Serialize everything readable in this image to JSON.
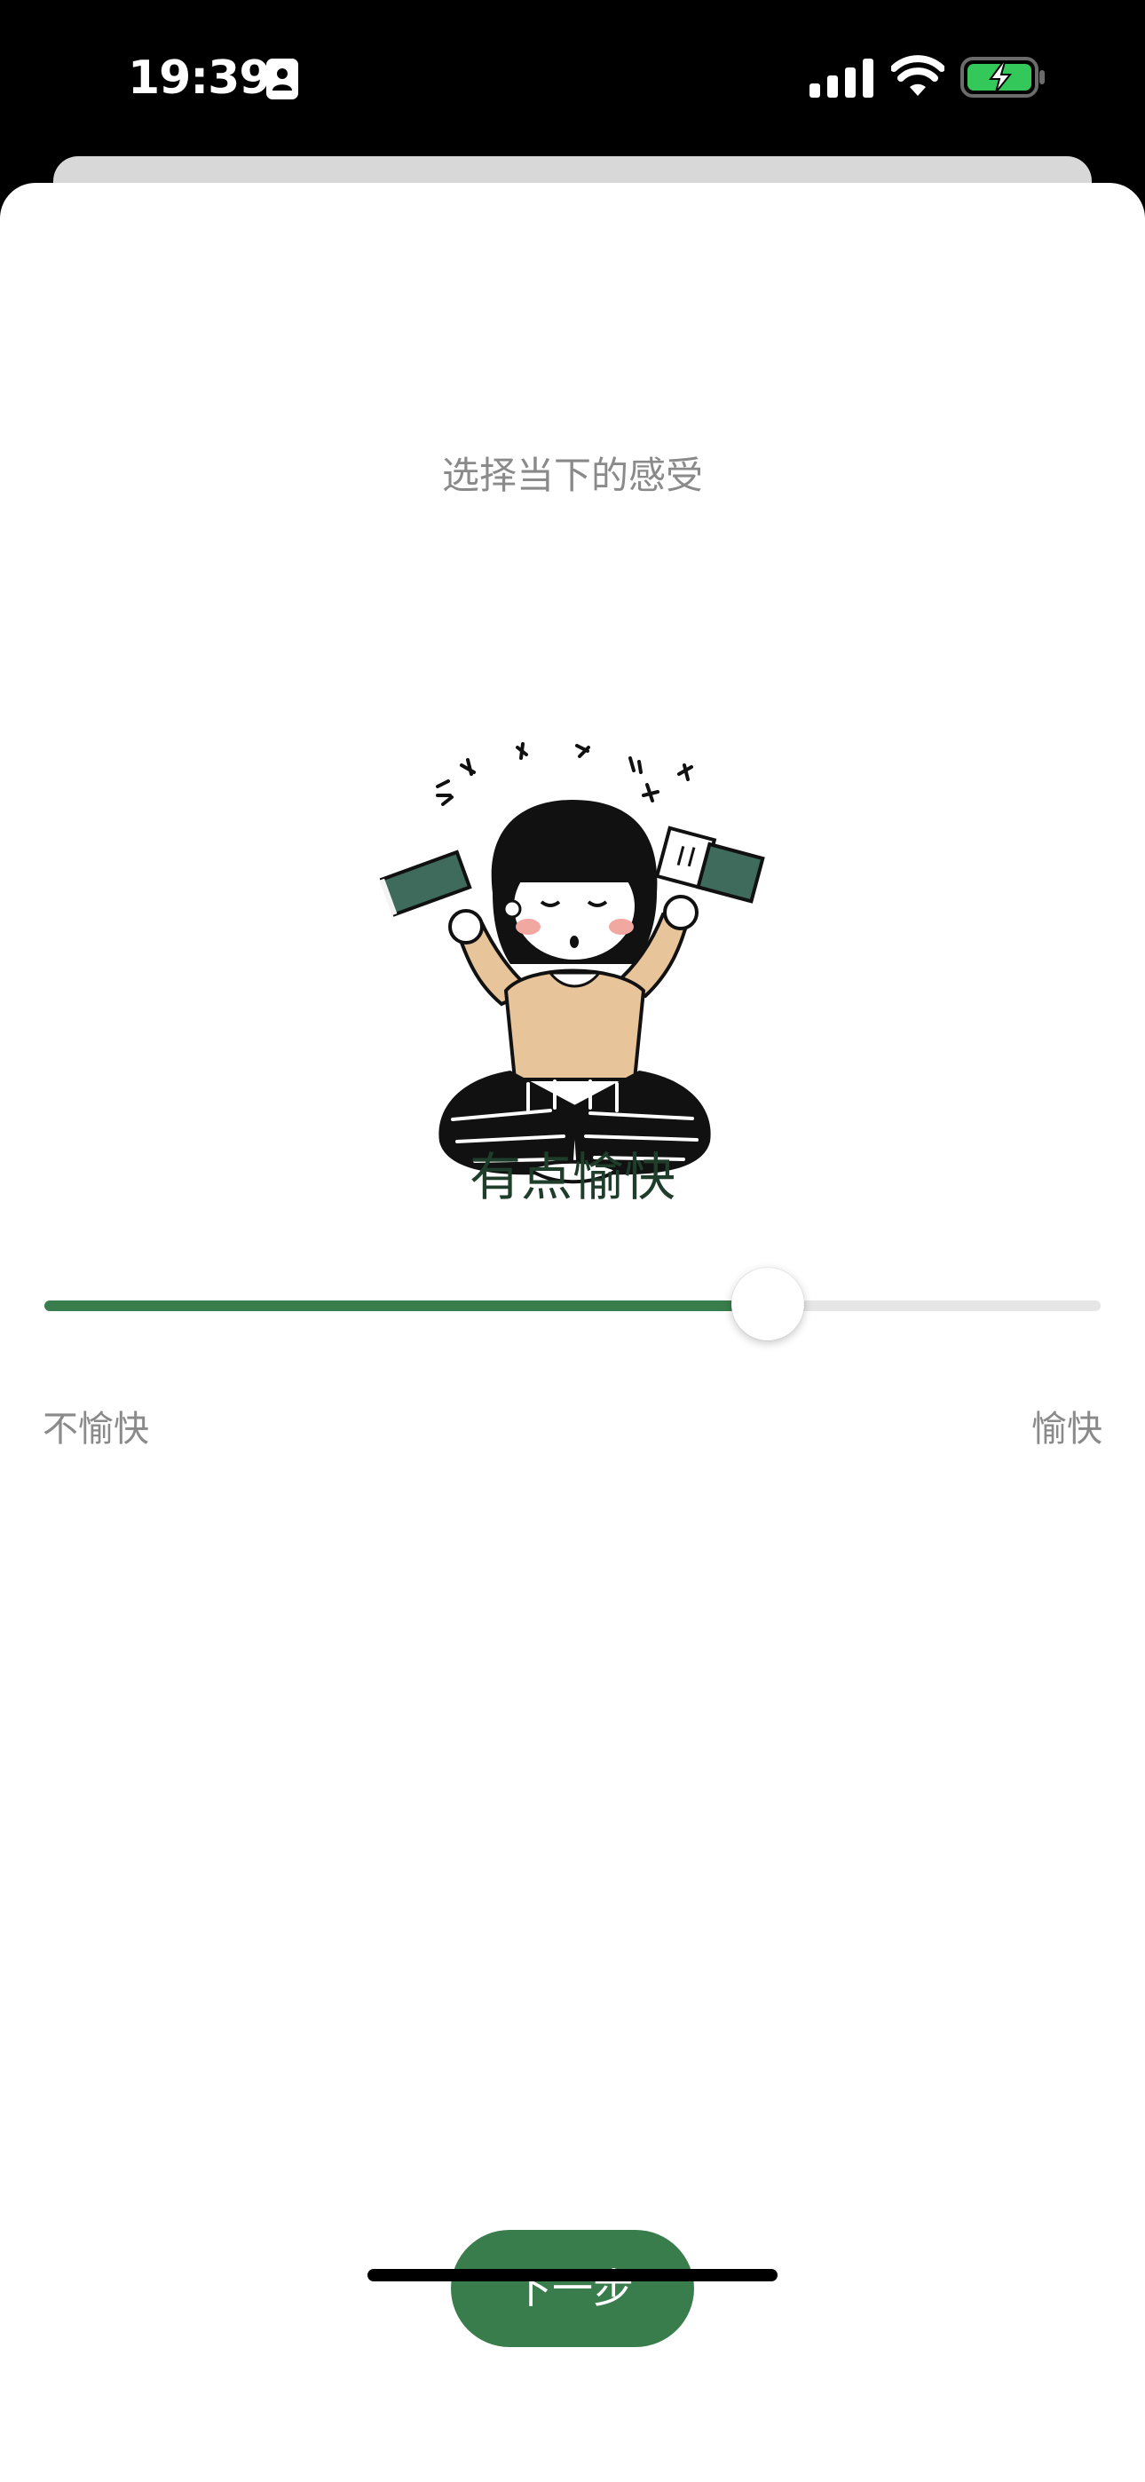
{
  "status_bar": {
    "time": "19:39",
    "icons": [
      "contact-card-icon",
      "cellular-signal-icon",
      "wifi-icon",
      "battery-charging-icon"
    ],
    "battery_color": "#34c759"
  },
  "screen": {
    "prompt": "选择当下的感受",
    "mood_label": "有点愉快",
    "illustration": "girl-holding-books-illustration"
  },
  "slider": {
    "value": 0.685,
    "min_label": "不愉快",
    "max_label": "愉快"
  },
  "actions": {
    "next_label": "下一步"
  },
  "colors": {
    "accent": "#3a7d4c",
    "track": "#e6e6e6",
    "muted_text": "#8a8a8a",
    "title_text": "#1f3d2b"
  }
}
